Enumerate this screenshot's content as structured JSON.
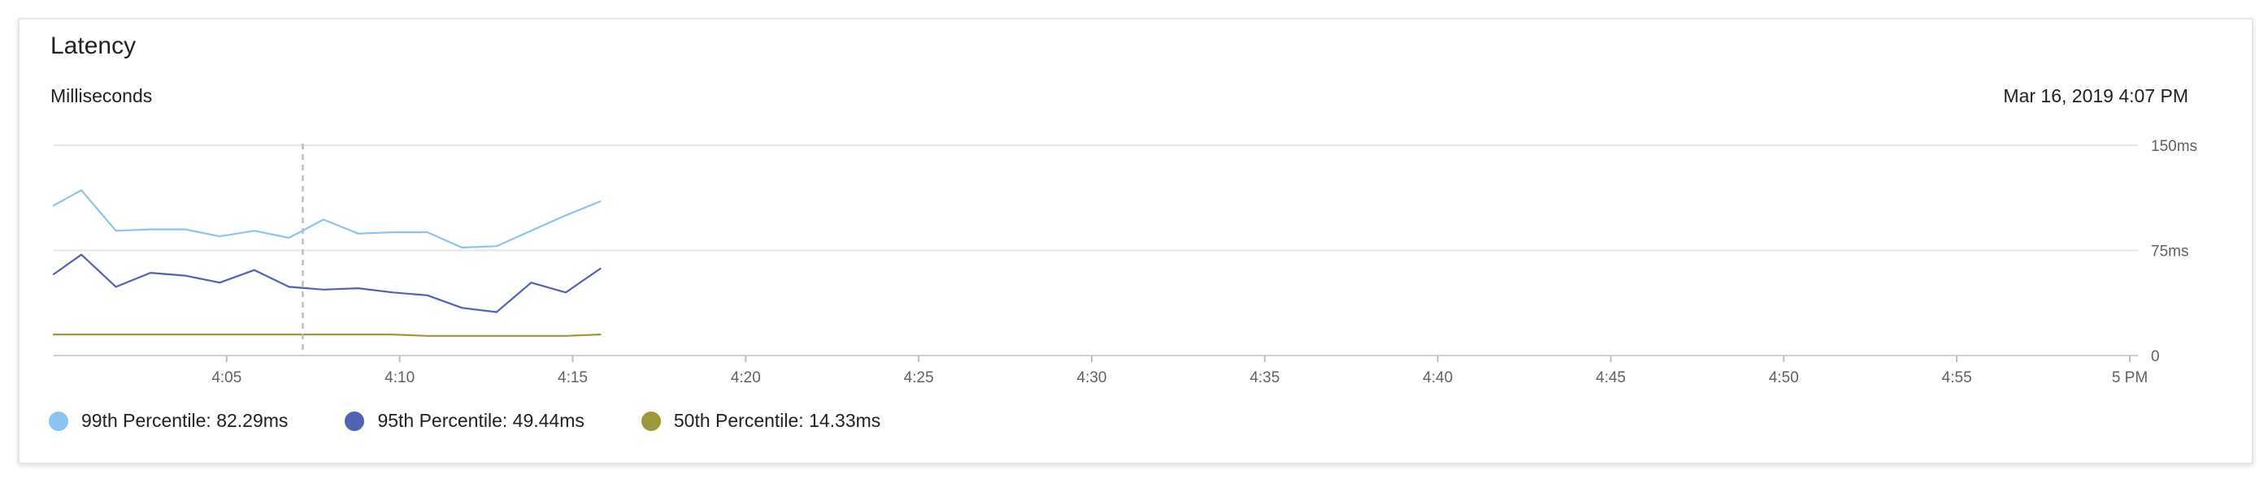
{
  "card": {
    "title": "Latency",
    "subtitle": "Milliseconds",
    "timestamp": "Mar 16, 2019 4:07 PM"
  },
  "colors": {
    "p99": "#8cc4ef",
    "p95": "#5062b3",
    "p50": "#9c983a",
    "grid": "#e6e6e6",
    "cursor": "#bdbdbd"
  },
  "chart_data": {
    "type": "line",
    "title": "Latency",
    "ylabel": "Milliseconds",
    "ylim": [
      0,
      150
    ],
    "y_ticks": [
      "0",
      "75ms",
      "150ms"
    ],
    "y_tick_values": [
      0,
      75,
      150
    ],
    "x_range_minutes": [
      0,
      60
    ],
    "x_ticks": [
      "4:05",
      "4:10",
      "4:15",
      "4:20",
      "4:25",
      "4:30",
      "4:35",
      "4:40",
      "4:45",
      "4:50",
      "4:55",
      "5 PM"
    ],
    "x_tick_minutes": [
      5,
      10,
      15,
      20,
      25,
      30,
      35,
      40,
      45,
      50,
      55,
      60
    ],
    "cursor_minute": 7.2,
    "grid": true,
    "legend_position": "bottom-left",
    "series": [
      {
        "name": "99th Percentile: 82.29ms",
        "color_key": "p99",
        "x": [
          0,
          0.8,
          1.8,
          2.8,
          3.8,
          4.8,
          5.8,
          6.8,
          7.8,
          8.8,
          9.8,
          10.8,
          11.8,
          12.8,
          13.8,
          14.8,
          15.8
        ],
        "y": [
          107,
          118,
          89,
          90,
          90,
          85,
          89,
          84,
          97,
          87,
          88,
          88,
          77,
          78,
          89,
          100,
          110
        ]
      },
      {
        "name": "95th Percentile: 49.44ms",
        "color_key": "p95",
        "x": [
          0,
          0.8,
          1.8,
          2.8,
          3.8,
          4.8,
          5.8,
          6.8,
          7.8,
          8.8,
          9.8,
          10.8,
          11.8,
          12.8,
          13.8,
          14.8,
          15.8
        ],
        "y": [
          58,
          72,
          49,
          59,
          57,
          52,
          61,
          49,
          47,
          48,
          45,
          43,
          34,
          31,
          52,
          45,
          62
        ]
      },
      {
        "name": "50th Percentile: 14.33ms",
        "color_key": "p50",
        "x": [
          0,
          0.8,
          1.8,
          2.8,
          3.8,
          4.8,
          5.8,
          6.8,
          7.8,
          8.8,
          9.8,
          10.8,
          11.8,
          12.8,
          13.8,
          14.8,
          15.8
        ],
        "y": [
          15,
          15,
          15,
          15,
          15,
          15,
          15,
          15,
          15,
          15,
          15,
          14,
          14,
          14,
          14,
          14,
          15
        ]
      }
    ]
  }
}
